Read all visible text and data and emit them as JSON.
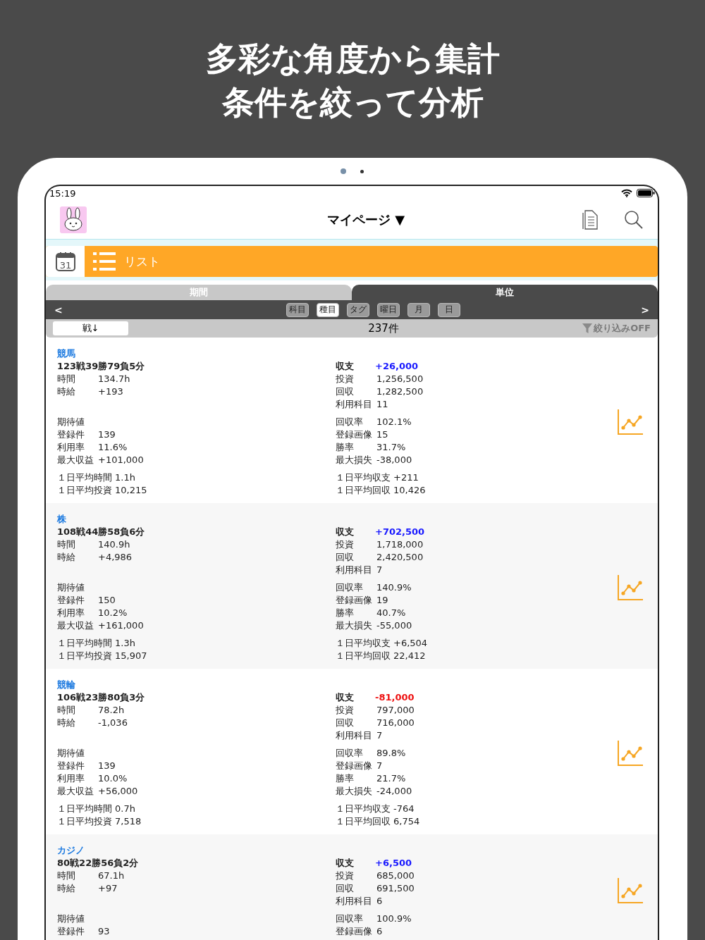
{
  "headline": [
    "多彩な角度から集計",
    "条件を絞って分析"
  ],
  "page_dots": [
    {
      "selected": true
    },
    {
      "selected": false
    }
  ],
  "status_bar": {
    "time": "15:19"
  },
  "nav": {
    "title": "マイページ ▼"
  },
  "mode_bar": {
    "calendar_day": "31",
    "label": "リスト"
  },
  "segments": [
    {
      "label": "期間",
      "selected": false
    },
    {
      "label": "単位",
      "selected": true
    }
  ],
  "unit_bar": {
    "prev": "<",
    "next": ">",
    "options": [
      {
        "label": "科目",
        "selected": false
      },
      {
        "label": "種目",
        "selected": true
      },
      {
        "label": "タグ",
        "selected": false
      },
      {
        "label": "曜日",
        "selected": false
      },
      {
        "label": "月",
        "selected": false
      },
      {
        "label": "日",
        "selected": false
      }
    ]
  },
  "filter_bar": {
    "sort": "戦↓",
    "count": "237件",
    "filter": "絞り込みOFF"
  },
  "cards": [
    {
      "title": "競馬",
      "record": "123戦39勝79負5分",
      "balance": {
        "label": "収支",
        "value": "+26,000",
        "color": "#1a1aff"
      },
      "groups": [
        {
          "left": [
            {
              "label": "時間",
              "value": "134.7h"
            },
            {
              "label": "時給",
              "value": "+193"
            }
          ],
          "right": [
            {
              "label": "投資",
              "value": "1,256,500"
            },
            {
              "label": "回収",
              "value": "1,282,500"
            },
            {
              "label": "利用科目",
              "value": "11"
            }
          ]
        },
        {
          "left": [
            {
              "label": "期待値"
            },
            {
              "label": "登録件",
              "value": "139"
            },
            {
              "label": "利用率",
              "value": "11.6%"
            },
            {
              "label": "最大収益",
              "value": "+101,000"
            }
          ],
          "right": [
            {
              "label": "回収率",
              "value": "102.1%"
            },
            {
              "label": "登録画像",
              "value": "15"
            },
            {
              "label": "勝率",
              "value": "31.7%"
            },
            {
              "label": "最大損失",
              "value": "-38,000"
            }
          ]
        },
        {
          "left": [
            {
              "label": "１日平均時間",
              "value": "1.1h"
            },
            {
              "label": "１日平均投資",
              "value": "10,215"
            }
          ],
          "right": [
            {
              "label": "１日平均収支",
              "value": "+211"
            },
            {
              "label": "１日平均回収",
              "value": "10,426"
            }
          ]
        }
      ]
    },
    {
      "title": "株",
      "record": "108戦44勝58負6分",
      "balance": {
        "label": "収支",
        "value": "+702,500",
        "color": "#1a1aff"
      },
      "groups": [
        {
          "left": [
            {
              "label": "時間",
              "value": "140.9h"
            },
            {
              "label": "時給",
              "value": "+4,986"
            }
          ],
          "right": [
            {
              "label": "投資",
              "value": "1,718,000"
            },
            {
              "label": "回収",
              "value": "2,420,500"
            },
            {
              "label": "利用科目",
              "value": "7"
            }
          ]
        },
        {
          "left": [
            {
              "label": "期待値"
            },
            {
              "label": "登録件",
              "value": "150"
            },
            {
              "label": "利用率",
              "value": "10.2%"
            },
            {
              "label": "最大収益",
              "value": "+161,000"
            }
          ],
          "right": [
            {
              "label": "回収率",
              "value": "140.9%"
            },
            {
              "label": "登録画像",
              "value": "19"
            },
            {
              "label": "勝率",
              "value": "40.7%"
            },
            {
              "label": "最大損失",
              "value": "-55,000"
            }
          ]
        },
        {
          "left": [
            {
              "label": "１日平均時間",
              "value": "1.3h"
            },
            {
              "label": "１日平均投資",
              "value": "15,907"
            }
          ],
          "right": [
            {
              "label": "１日平均収支",
              "value": "+6,504"
            },
            {
              "label": "１日平均回収",
              "value": "22,412"
            }
          ]
        }
      ]
    },
    {
      "title": "競輪",
      "record": "106戦23勝80負3分",
      "balance": {
        "label": "収支",
        "value": "-81,000",
        "color": "#ee1111"
      },
      "groups": [
        {
          "left": [
            {
              "label": "時間",
              "value": "78.2h"
            },
            {
              "label": "時給",
              "value": "-1,036"
            }
          ],
          "right": [
            {
              "label": "投資",
              "value": "797,000"
            },
            {
              "label": "回収",
              "value": "716,000"
            },
            {
              "label": "利用科目",
              "value": "7"
            }
          ]
        },
        {
          "left": [
            {
              "label": "期待値"
            },
            {
              "label": "登録件",
              "value": "139"
            },
            {
              "label": "利用率",
              "value": "10.0%"
            },
            {
              "label": "最大収益",
              "value": "+56,000"
            }
          ],
          "right": [
            {
              "label": "回収率",
              "value": "89.8%"
            },
            {
              "label": "登録画像",
              "value": "7"
            },
            {
              "label": "勝率",
              "value": "21.7%"
            },
            {
              "label": "最大損失",
              "value": "-24,000"
            }
          ]
        },
        {
          "left": [
            {
              "label": "１日平均時間",
              "value": "0.7h"
            },
            {
              "label": "１日平均投資",
              "value": "7,518"
            }
          ],
          "right": [
            {
              "label": "１日平均収支",
              "value": "-764"
            },
            {
              "label": "１日平均回収",
              "value": "6,754"
            }
          ]
        }
      ]
    },
    {
      "title": "カジノ",
      "record": "80戦22勝56負2分",
      "balance": {
        "label": "収支",
        "value": "+6,500",
        "color": "#1a1aff"
      },
      "groups": [
        {
          "left": [
            {
              "label": "時間",
              "value": "67.1h"
            },
            {
              "label": "時給",
              "value": "+97"
            }
          ],
          "right": [
            {
              "label": "投資",
              "value": "685,000"
            },
            {
              "label": "回収",
              "value": "691,500"
            },
            {
              "label": "利用科目",
              "value": "6"
            }
          ]
        },
        {
          "left": [
            {
              "label": "期待値"
            },
            {
              "label": "登録件",
              "value": "93"
            }
          ],
          "right": [
            {
              "label": "回収率",
              "value": "100.9%"
            },
            {
              "label": "登録画像",
              "value": "6"
            }
          ]
        }
      ]
    }
  ]
}
